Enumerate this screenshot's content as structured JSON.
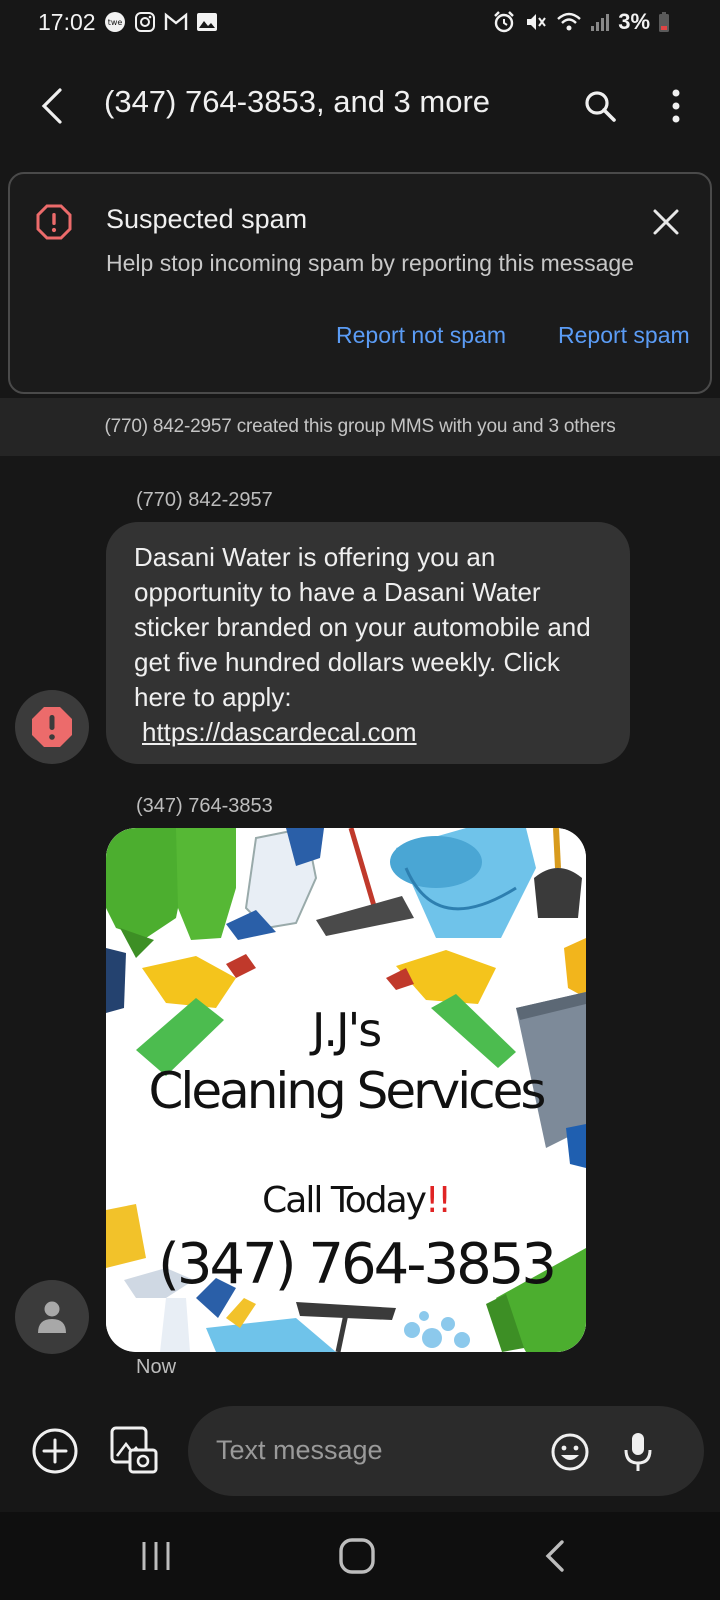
{
  "status_bar": {
    "time": "17:02",
    "battery_percent": "3%",
    "left_icons": [
      "news-icon",
      "instagram-icon",
      "gmail-icon",
      "gallery-icon"
    ],
    "right_icons": [
      "alarm-icon",
      "mute-icon",
      "wifi-icon",
      "signal-icon",
      "battery-low-icon"
    ]
  },
  "header": {
    "title": "(347) 764-3853, and 3 more"
  },
  "spam_banner": {
    "title": "Suspected spam",
    "description": "Help stop incoming spam by reporting this message",
    "report_not_spam": "Report not spam",
    "report_spam": "Report spam",
    "accent_color": "#5b9cf5",
    "alert_color": "#ec6b6b"
  },
  "group_info": "(770) 842-2957 created this group MMS with you and 3 others",
  "messages": [
    {
      "sender": "(770) 842-2957",
      "text": "Dasani Water is offering you an opportunity to have a Dasani Water sticker branded on your automobile and get five hundred dollars weekly. Click here to apply:",
      "link": "https://dascardecal.com"
    },
    {
      "sender": "(347) 764-3853",
      "image": {
        "line1": "J.J's",
        "line2": "Cleaning Services",
        "line3": "Call Today",
        "line3_mark": "!!",
        "line4": "(347) 764-3853"
      },
      "timestamp": "Now"
    }
  ],
  "composer": {
    "placeholder": "Text message"
  }
}
